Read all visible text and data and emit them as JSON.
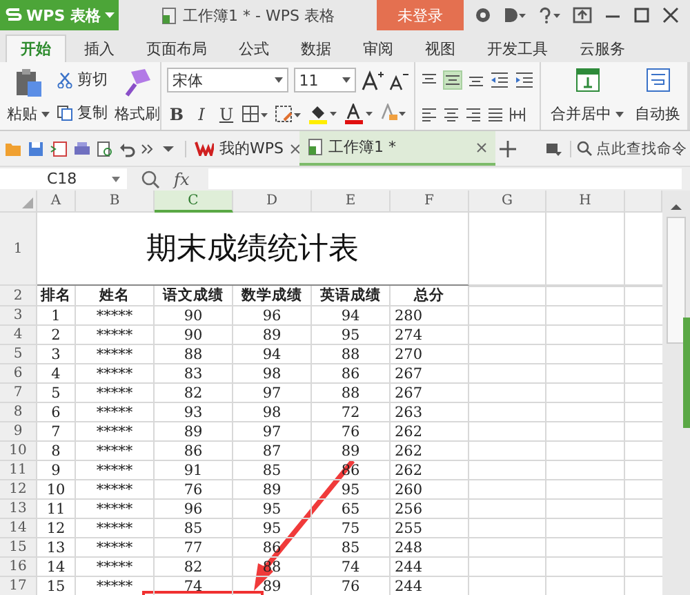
{
  "title_bar": {
    "app_menu": "WPS 表格",
    "title": "工作簿1 * - WPS 表格",
    "login": "未登录"
  },
  "ribbon_tabs": [
    {
      "label": "开始",
      "selected": true
    },
    {
      "label": "插入",
      "selected": false
    },
    {
      "label": "页面布局",
      "selected": false
    },
    {
      "label": "公式",
      "selected": false
    },
    {
      "label": "数据",
      "selected": false
    },
    {
      "label": "审阅",
      "selected": false
    },
    {
      "label": "视图",
      "selected": false
    },
    {
      "label": "开发工具",
      "selected": false
    },
    {
      "label": "云服务",
      "selected": false
    }
  ],
  "ribbon": {
    "paste": "粘贴",
    "cut": "剪切",
    "copy": "复制",
    "format_painter": "格式刷",
    "font": "宋体",
    "font_size": "11",
    "bold": "B",
    "italic": "I",
    "underline": "U",
    "merge": "合并居中",
    "wrap": "自动换",
    "vertical_align": [
      {
        "selected": false
      },
      {
        "selected": true
      },
      {
        "selected": false
      }
    ]
  },
  "doc_tabs": [
    {
      "label": "我的WPS",
      "kind": "home",
      "selected": false
    },
    {
      "label": "工作簿1 *",
      "kind": "sheet",
      "selected": true
    }
  ],
  "command_search": {
    "placeholder": "点此查找命令"
  },
  "formula_bar": {
    "cell_ref": "C18",
    "fx": "fx"
  },
  "sheet": {
    "columns": [
      {
        "label": "A",
        "selected": false
      },
      {
        "label": "B",
        "selected": false
      },
      {
        "label": "C",
        "selected": true
      },
      {
        "label": "D",
        "selected": false
      },
      {
        "label": "E",
        "selected": false
      },
      {
        "label": "F",
        "selected": false
      },
      {
        "label": "G",
        "selected": false
      },
      {
        "label": "H",
        "selected": false
      }
    ],
    "title_row": "1",
    "title": "期末成绩统计表",
    "header_row": "2",
    "header": [
      "排名",
      "姓名",
      "语文成绩",
      "数学成绩",
      "英语成绩",
      "总分"
    ],
    "rows": [
      {
        "row": "3",
        "cells": [
          "1",
          "*****",
          "90",
          "96",
          "94",
          "280"
        ]
      },
      {
        "row": "4",
        "cells": [
          "2",
          "*****",
          "90",
          "89",
          "95",
          "274"
        ]
      },
      {
        "row": "5",
        "cells": [
          "3",
          "*****",
          "88",
          "94",
          "88",
          "270"
        ]
      },
      {
        "row": "6",
        "cells": [
          "4",
          "*****",
          "83",
          "98",
          "86",
          "267"
        ]
      },
      {
        "row": "7",
        "cells": [
          "5",
          "*****",
          "82",
          "97",
          "88",
          "267"
        ]
      },
      {
        "row": "8",
        "cells": [
          "6",
          "*****",
          "93",
          "98",
          "72",
          "263"
        ]
      },
      {
        "row": "9",
        "cells": [
          "7",
          "*****",
          "89",
          "97",
          "76",
          "262"
        ]
      },
      {
        "row": "10",
        "cells": [
          "8",
          "*****",
          "86",
          "87",
          "89",
          "262"
        ]
      },
      {
        "row": "11",
        "cells": [
          "9",
          "*****",
          "91",
          "85",
          "86",
          "262"
        ]
      },
      {
        "row": "12",
        "cells": [
          "10",
          "*****",
          "76",
          "89",
          "95",
          "260"
        ]
      },
      {
        "row": "13",
        "cells": [
          "11",
          "*****",
          "96",
          "95",
          "65",
          "256"
        ]
      },
      {
        "row": "14",
        "cells": [
          "12",
          "*****",
          "85",
          "95",
          "75",
          "255"
        ]
      },
      {
        "row": "15",
        "cells": [
          "13",
          "*****",
          "77",
          "86",
          "85",
          "248"
        ]
      },
      {
        "row": "16",
        "cells": [
          "14",
          "*****",
          "82",
          "88",
          "74",
          "244"
        ]
      },
      {
        "row": "17",
        "cells": [
          "15",
          "*****",
          "74",
          "89",
          "76",
          "244"
        ]
      }
    ]
  }
}
